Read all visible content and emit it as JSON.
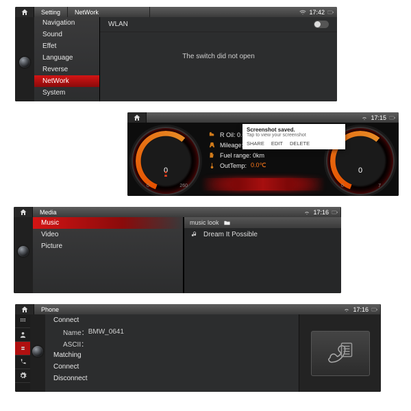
{
  "settings": {
    "title": "Setting",
    "subtitle": "NetWork",
    "time": "17:42",
    "menu": [
      "Navigation",
      "Sound",
      "Effet",
      "Language",
      "Reverse",
      "NetWork",
      "System"
    ],
    "selected": 5,
    "wlan_label": "WLAN",
    "wlan_on": false,
    "message": "The switch did not open"
  },
  "dashboard": {
    "time": "17:15",
    "popup": {
      "title": "Screenshot saved.",
      "subtitle": "Tap to view your screenshot",
      "buttons": [
        "SHARE",
        "EDIT",
        "DELETE"
      ]
    },
    "left_gauge": {
      "value": "0",
      "min": "0",
      "max": "260"
    },
    "right_gauge": {
      "value": "0",
      "min": "0",
      "max": "7"
    },
    "info": [
      {
        "icon": "fuel",
        "label": "R Oil:  0.0L"
      },
      {
        "icon": "road",
        "label": "Mileage: 0km"
      },
      {
        "icon": "range",
        "label": "Fuel range: 0km"
      },
      {
        "icon": "temp",
        "label": "OutTemp:",
        "value": "0.0℃"
      }
    ]
  },
  "media": {
    "title": "Media",
    "time": "17:16",
    "menu": [
      "Music",
      "Video",
      "Picture"
    ],
    "selected": 0,
    "folder": "music look",
    "tracks": [
      "Dream It Possible"
    ]
  },
  "phone": {
    "title": "Phone",
    "time": "17:16",
    "section": "Connect",
    "name_label": "Name：",
    "name_value": "BMW_0641",
    "ascii_label": "ASCII：",
    "items": [
      "Matching",
      "Connect",
      "Disconnect"
    ]
  }
}
